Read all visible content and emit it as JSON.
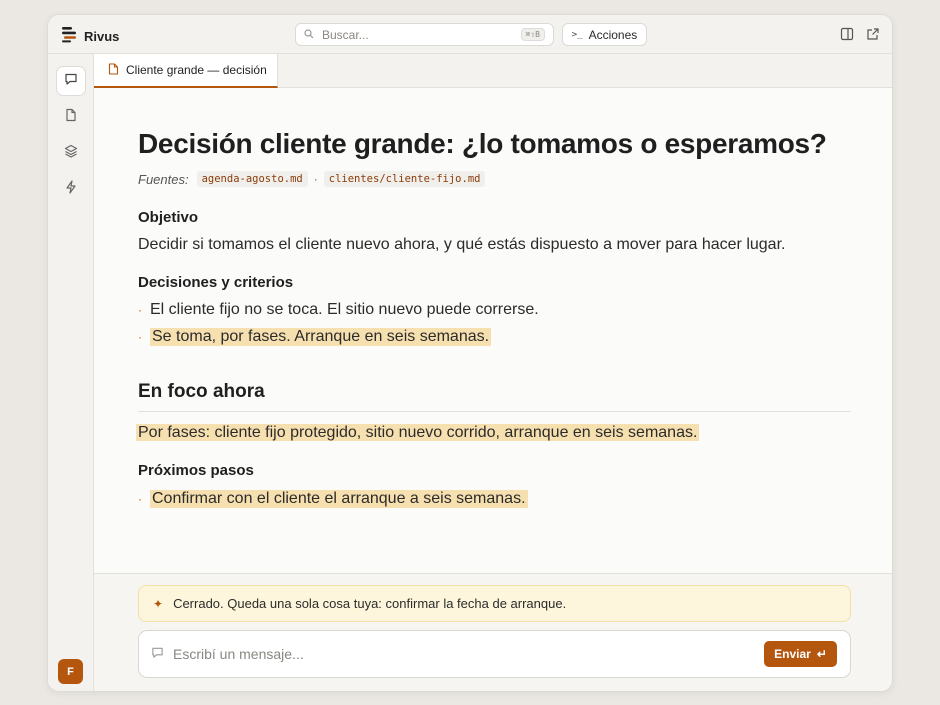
{
  "app": {
    "name": "Rivus",
    "accent": "#b5560f"
  },
  "search": {
    "placeholder": "Buscar...",
    "shortcut": "⌘⇧B"
  },
  "toolbar": {
    "actions_label": "Acciones",
    "actions_prompt": ">_"
  },
  "sidebar": {
    "items": [
      {
        "icon": "chat-icon",
        "active": true
      },
      {
        "icon": "document-icon",
        "active": false
      },
      {
        "icon": "layers-icon",
        "active": false
      },
      {
        "icon": "bolt-icon",
        "active": false
      }
    ],
    "avatar_initial": "F"
  },
  "tabs": [
    {
      "label": "Cliente grande — decisión",
      "icon": "document-icon",
      "active": true
    }
  ],
  "document": {
    "title": "Decisión cliente grande: ¿lo tomamos o esperamos?",
    "sources_label": "Fuentes:",
    "sources": [
      "agenda-agosto.md",
      "clientes/cliente-fijo.md"
    ],
    "sources_separator": "·",
    "objective_heading": "Objetivo",
    "objective_text": "Decidir si tomamos el cliente nuevo ahora, y qué estás dispuesto a mover para hacer lugar.",
    "decisions_heading": "Decisiones y criterios",
    "decisions": [
      {
        "text": "El cliente fijo no se toca. El sitio nuevo puede correrse.",
        "highlight": false
      },
      {
        "text": "Se toma, por fases. Arranque en seis semanas.",
        "highlight": true
      }
    ],
    "focus_heading": "En foco ahora",
    "focus_text": "Por fases: cliente fijo protegido, sitio nuevo corrido, arranque en seis semanas.",
    "next_heading": "Próximos pasos",
    "next_steps": [
      {
        "text": "Confirmar con el cliente el arranque a seis semanas.",
        "highlight": true
      }
    ]
  },
  "notice": {
    "text": "Cerrado. Queda una sola cosa tuya: confirmar la fecha de arranque."
  },
  "composer": {
    "placeholder": "Escribí un mensaje...",
    "send_label": "Enviar",
    "send_icon": "↵"
  }
}
